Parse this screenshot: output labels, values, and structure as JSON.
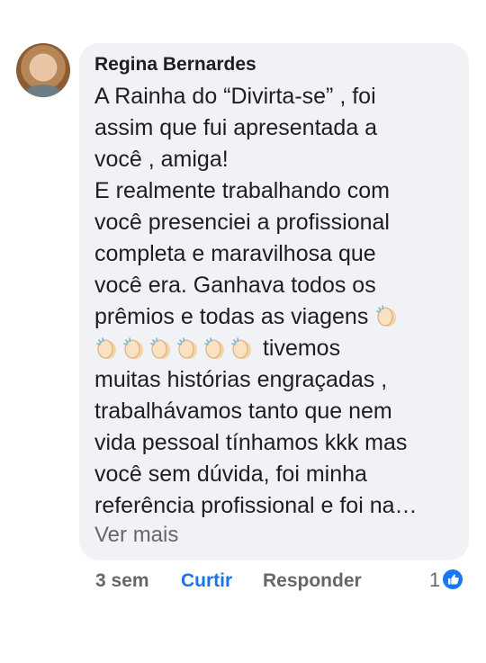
{
  "comment": {
    "author": "Regina Bernardes",
    "text_lines": [
      "A Rainha do “Divirta-se” , foi",
      "assim que fui apresentada  a",
      "você , amiga!",
      "E realmente trabalhando com",
      "você presenciei a profissional",
      "completa e maravilhosa que",
      "você era. Ganhava todos os",
      "prêmios e todas as viagens",
      "tivemos",
      "muitas histórias engraçadas ,",
      "trabalhávamos tanto que nem",
      "vida pessoal tínhamos kkk mas",
      "você sem dúvida, foi minha",
      "referência profissional e foi na…"
    ],
    "emoji": "clapping-hands",
    "see_more": "Ver mais"
  },
  "actions": {
    "time": "3 sem",
    "like": "Curtir",
    "reply": "Responder"
  },
  "reactions": {
    "count": "1",
    "icon": "like-thumb-icon",
    "color": "#1877f2"
  }
}
